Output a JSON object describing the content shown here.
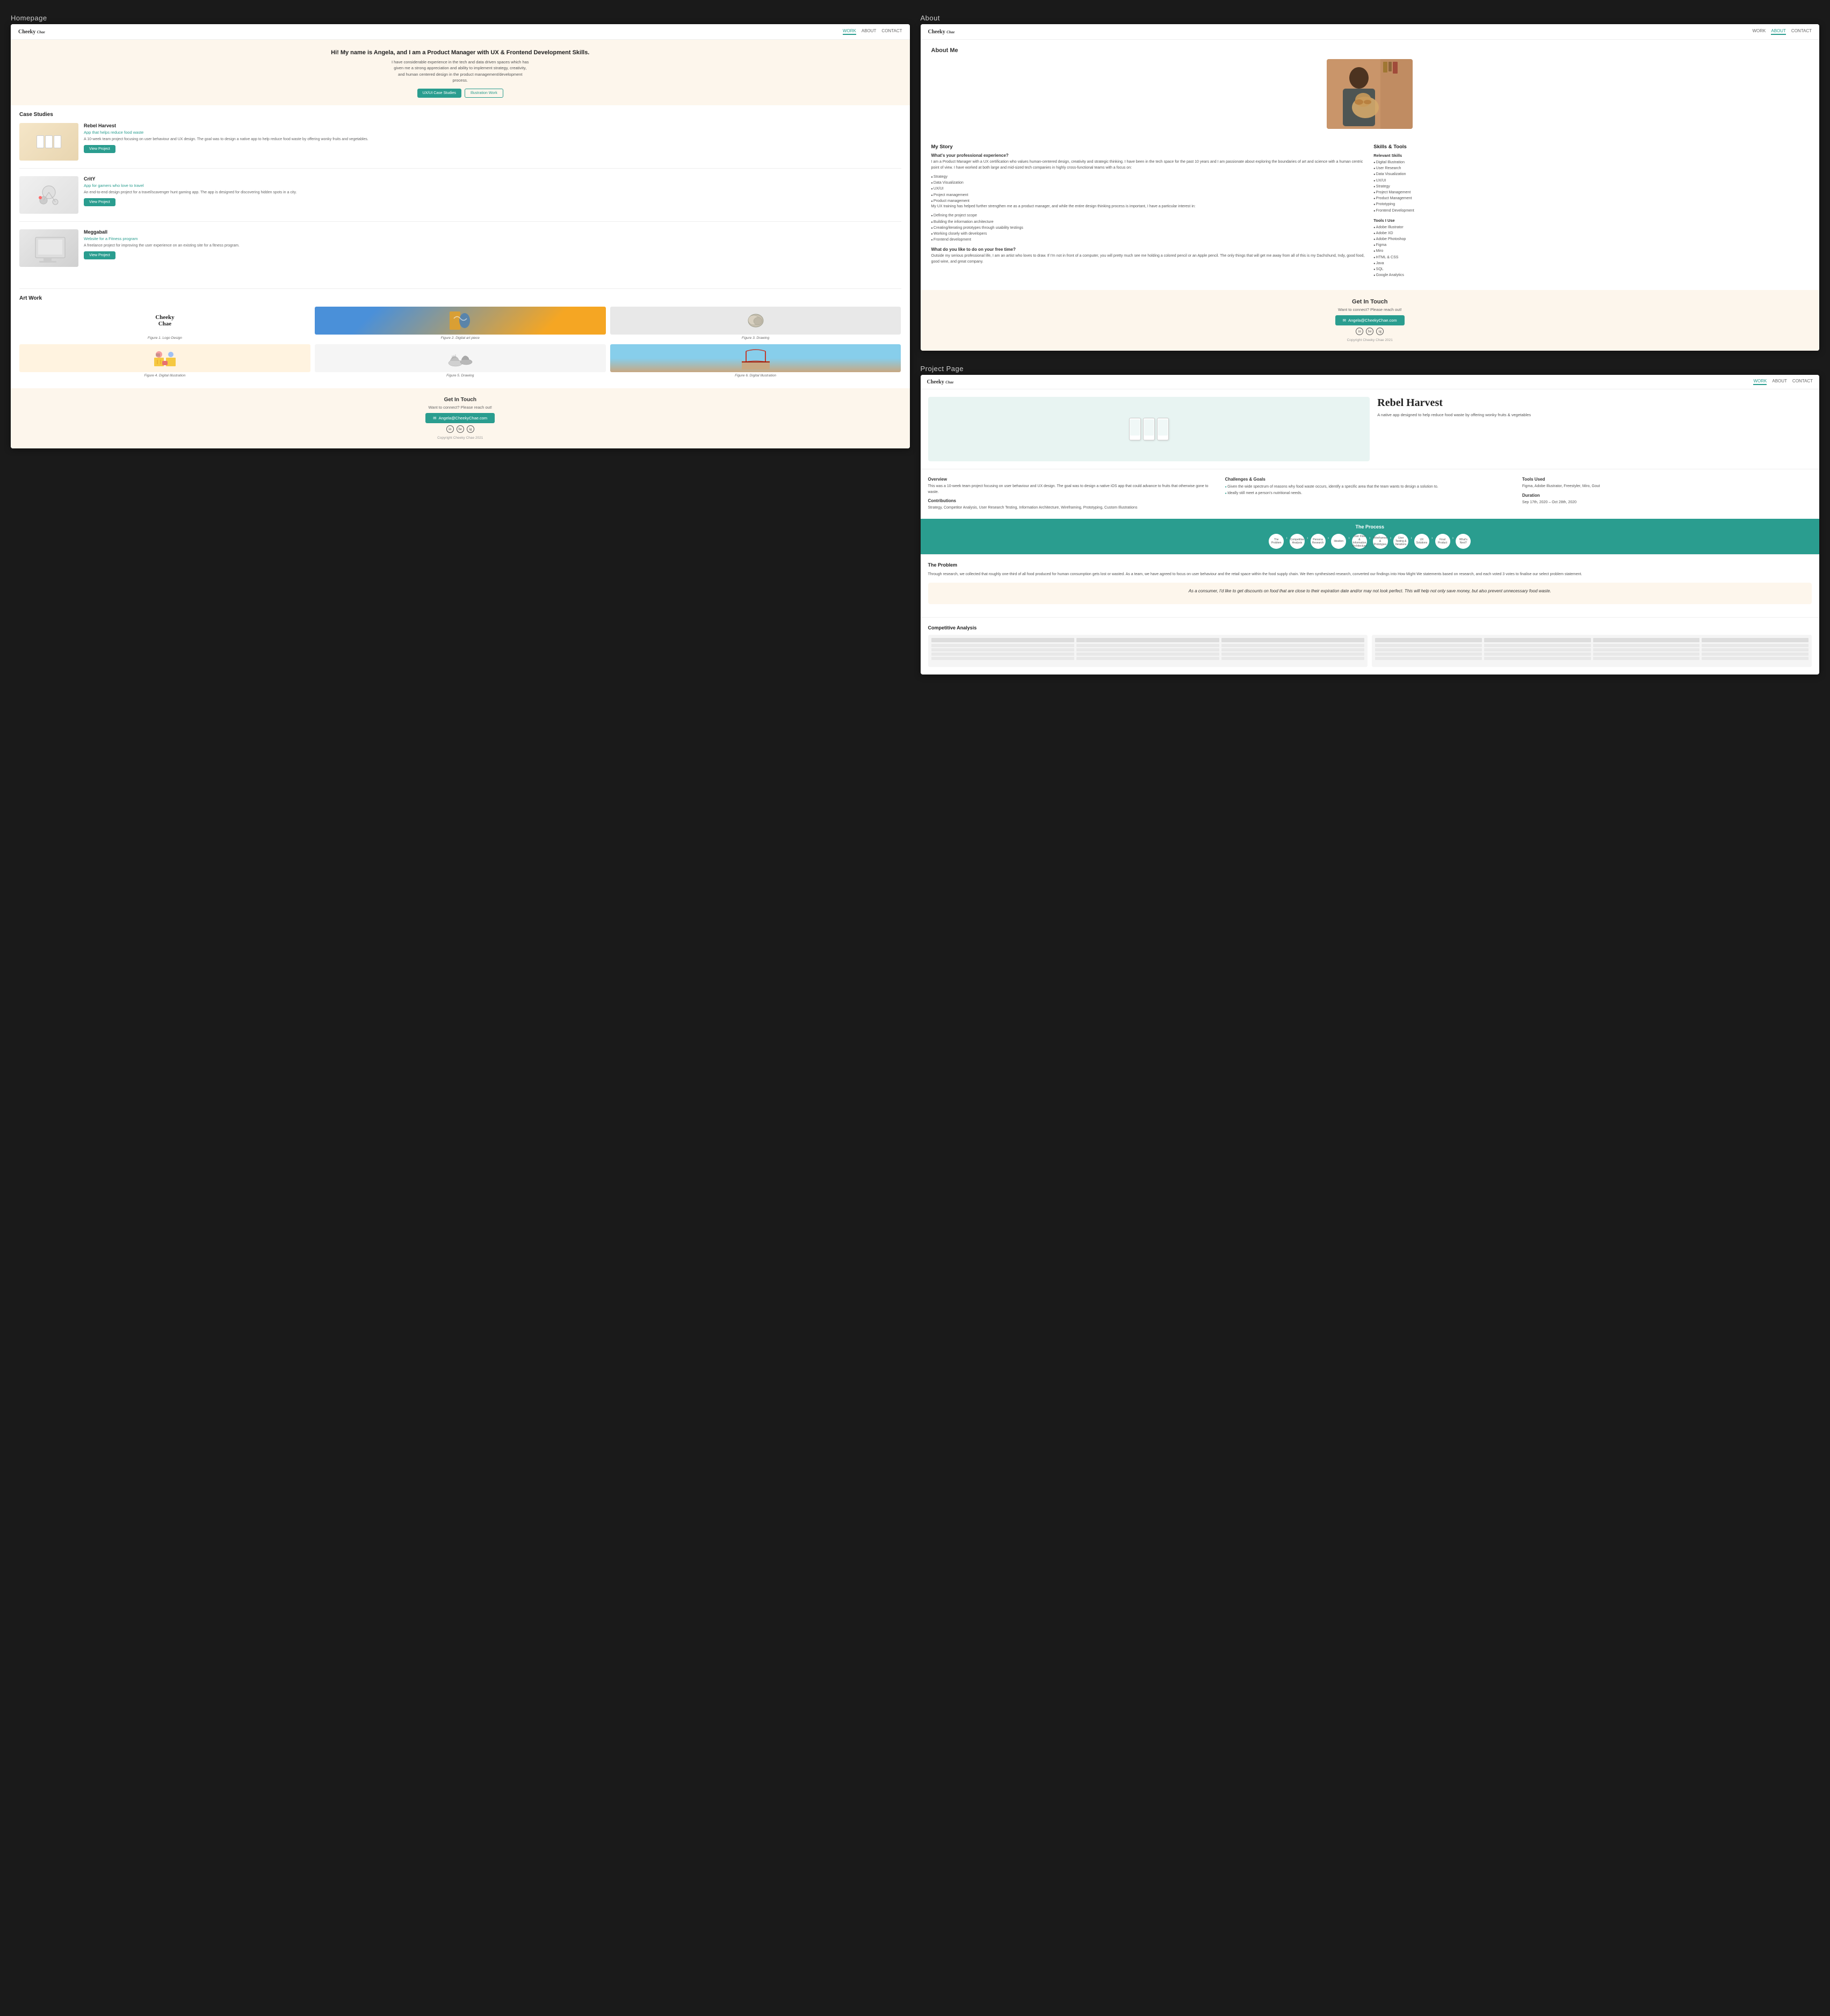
{
  "homepage": {
    "label": "Homepage",
    "nav": {
      "logo_line1": "Cheeky",
      "logo_line2": "Chae",
      "links": [
        "WORK",
        "ABOUT",
        "CONTACT"
      ],
      "active": "WORK"
    },
    "hero": {
      "heading": "Hi! My name is Angela, and I am a Product Manager with UX & Frontend Development Skills.",
      "body": "I have considerable experience in the tech and data driven spaces which has given me a strong appreciation and ability to implement strategy, creativity, and human centered design in the product management/development process.",
      "btn1": "UX/UI Case Studies",
      "btn2": "Illustration Work"
    },
    "case_studies_title": "Case Studies",
    "case_studies": [
      {
        "title": "Rebel Harvest",
        "subtitle": "App that helps reduce food waste",
        "description": "A 10-week team project focusing on user behaviour and UX design. The goal was to design a native app to help reduce food waste by offering wonky fruits and vegetables.",
        "btn": "View Project"
      },
      {
        "title": "CritY",
        "subtitle": "App for gamers who love to travel",
        "description": "An end-to-end design project for a travel/scavenger hunt gaming app. The app is designed for discovering hidden spots in a city.",
        "btn": "View Project"
      },
      {
        "title": "Meggaball",
        "subtitle": "Website for a Fitness program",
        "description": "A freelance project for improving the user experience on an existing site for a fitness program.",
        "btn": "View Project"
      }
    ],
    "art_work_title": "Art Work",
    "art_items": [
      {
        "caption": "Figure 1. Logo Design"
      },
      {
        "caption": "Figure 2. Digital art piece"
      },
      {
        "caption": "Figure 3. Drawing"
      },
      {
        "caption": "Figure 4. Digital Illustration"
      },
      {
        "caption": "Figure 5. Drawing"
      },
      {
        "caption": "Figure 6. Digital Illustration"
      }
    ],
    "footer": {
      "title": "Get In Touch",
      "subtitle": "Want to connect? Please reach out!",
      "email_btn": "Angela@CheekyChae.com",
      "copyright": "Copyright Cheeky Chae 2021"
    }
  },
  "about": {
    "label": "About",
    "nav": {
      "logo_line1": "Cheeky",
      "logo_line2": "Chae",
      "links": [
        "WORK",
        "ABOUT",
        "CONTACT"
      ],
      "active": "ABOUT"
    },
    "title": "About Me",
    "story": {
      "title": "My Story",
      "q1": "What's your professional experience?",
      "p1": "I am a Product Manager with a UX certification who values human-centered design, creativity and strategic thinking. I have been in the tech space for the past 10 years and I am passionate about exploring the boundaries of art and science with a human centric point of view. I have worked at both large and mid-sized tech companies in highly cross-functional teams with a focus on:",
      "list1": [
        "Strategy",
        "Data Visualization",
        "UX/UI",
        "Project management",
        "Product management"
      ],
      "p2": "My UX training has helped further strengthen me as a product manager, and while the entire design thinking process is important, I have a particular interest in:",
      "list2": [
        "Defining the project scope",
        "Building the information architecture",
        "Creating/iterating prototypes through usability testings",
        "Working closely with developers",
        "Frontend development"
      ],
      "q2": "What do you like to do on your free time?",
      "p3": "Outside my serious professional life, I am an artist who loves to draw. If I'm not in front of a computer, you will pretty much see me holding a colored pencil or an Apple pencil. The only things that will get me away from all of this is my Dachshund, Indy, good food, good wine, and great company."
    },
    "skills": {
      "title": "Skills & Tools",
      "relevant_title": "Relevant Skills",
      "relevant_list": [
        "Digital Illustration",
        "User Research",
        "Data Visualization",
        "UX/UI",
        "Strategy",
        "Project Management",
        "Product Management",
        "Prototyping",
        "Frontend Development"
      ],
      "tools_title": "Tools I Use",
      "tools_list": [
        "Adobe Illustrator",
        "Adobe XD",
        "Adobe Photoshop",
        "Figma",
        "Miro",
        "HTML & CSS",
        "Java",
        "SQL",
        "Google Analytics"
      ]
    },
    "footer": {
      "title": "Get In Touch",
      "subtitle": "Want to connect? Please reach out!",
      "email_btn": "Angela@CheekyChae.com",
      "social": [
        "in",
        "be",
        "ig"
      ],
      "copyright": "Copyright Cheeky Chae 2021"
    }
  },
  "project_page": {
    "label": "Project Page",
    "nav": {
      "logo_line1": "Cheeky",
      "logo_line2": "Chae",
      "links": [
        "WORK",
        "ABOUT",
        "CONTACT"
      ],
      "active": "WORK"
    },
    "hero": {
      "title": "Rebel Harvest",
      "subtitle": "A native app designed to help reduce food waste by offering wonky fruits & vegetables"
    },
    "overview": {
      "title": "Overview",
      "body": "This was a 10-week team project focusing on user behaviour and UX design. The goal was to design a native iOS app that could advance to fruits that otherwise gone to waste."
    },
    "challenges": {
      "title": "Challenges & Goals",
      "items": [
        "Given the wide spectrum of reasons why food waste occurs, identify a specific area that the team wants to design a solution to.",
        "Ideally still meet a person's nutritional needs."
      ]
    },
    "tools": {
      "title": "Tools Used",
      "body": "Figma, Adobe Illustrator, Freestyler, Miro, Gout"
    },
    "contributions": {
      "title": "Contributions",
      "body": "Strategy, Competitor Analysis, User Research Testing, Information Architecture, Wireframing, Prototyping, Custom Illustrations"
    },
    "duration": {
      "title": "Duration",
      "body": "Sep 17th, 2020 – Oct 28th, 2020"
    },
    "process": {
      "title": "The Process",
      "steps": [
        "The Problem",
        "Competitive Analysis",
        "Persona Research",
        "Ideation",
        "User Flow & Information Architecture",
        "Wireframes & Prototypes",
        "User Testing & Iterations",
        "UX Solutions",
        "Final Product",
        "What's Next?"
      ]
    },
    "problem": {
      "title": "The Problem",
      "body": "Through research, we collected that roughly one-third of all food produced for human consumption gets lost or wasted. As a team, we have agreed to focus on user behaviour and the retail space within the food supply chain. We then synthesised research, converted our findings into How Might We statements based on research, and each voted 3 votes to finalise our select problem statement.",
      "statement": "As a consumer, I'd like to get discounts on food that are close to their expiration date and/or may not look perfect. This will help not only save money, but also prevent unnecessary food waste."
    },
    "competitive": {
      "title": "Competitive Analysis"
    }
  }
}
